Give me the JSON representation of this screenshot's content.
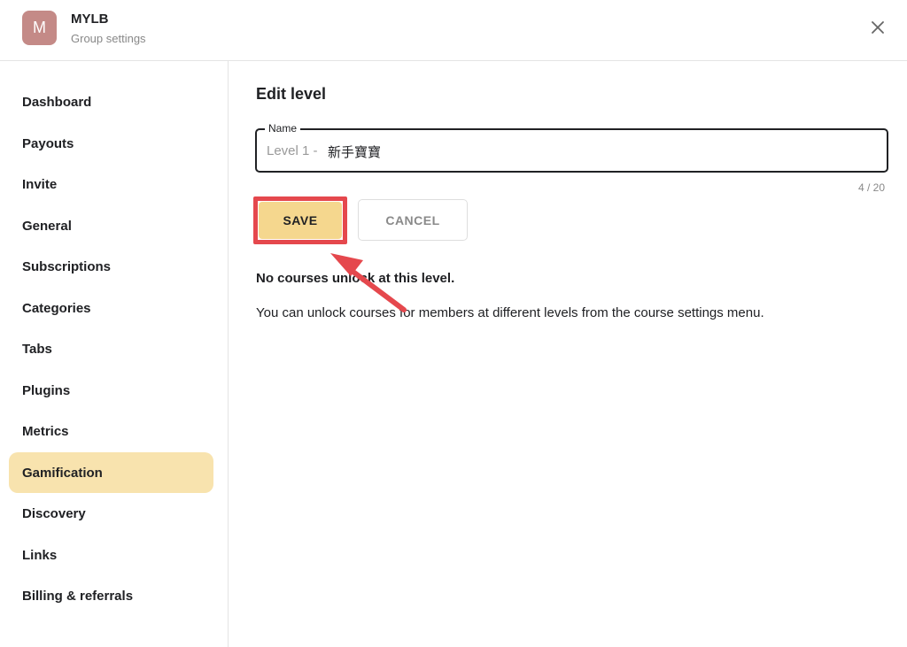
{
  "header": {
    "avatar_letter": "M",
    "group_name": "MYLB",
    "subtitle": "Group settings",
    "close_glyph": "close-icon"
  },
  "sidebar": {
    "items": [
      {
        "label": "Dashboard",
        "active": false
      },
      {
        "label": "Payouts",
        "active": false
      },
      {
        "label": "Invite",
        "active": false
      },
      {
        "label": "General",
        "active": false
      },
      {
        "label": "Subscriptions",
        "active": false
      },
      {
        "label": "Categories",
        "active": false
      },
      {
        "label": "Tabs",
        "active": false
      },
      {
        "label": "Plugins",
        "active": false
      },
      {
        "label": "Metrics",
        "active": false
      },
      {
        "label": "Gamification",
        "active": true
      },
      {
        "label": "Discovery",
        "active": false
      },
      {
        "label": "Links",
        "active": false
      },
      {
        "label": "Billing & referrals",
        "active": false
      }
    ]
  },
  "main": {
    "title": "Edit level",
    "name_field": {
      "label": "Name",
      "prefix": "Level 1 -",
      "value": "新手寶寶",
      "counter": "4 / 20"
    },
    "save_label": "SAVE",
    "cancel_label": "CANCEL",
    "no_courses_text": "No courses unlock at this level.",
    "info_text": "You can unlock courses for members at different levels from the course settings menu."
  },
  "colors": {
    "accent": "#f5d78e",
    "active_nav": "#f8e3ae",
    "highlight": "#e5484d",
    "avatar": "#c48a87"
  }
}
